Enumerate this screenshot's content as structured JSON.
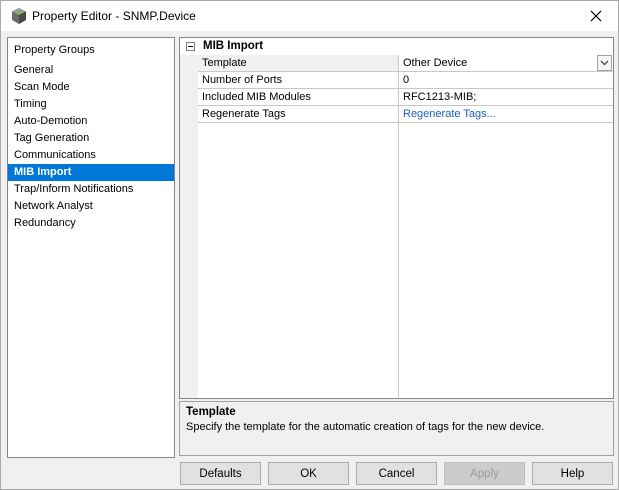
{
  "window": {
    "title": "Property Editor - SNMP.Device"
  },
  "groups": {
    "header": "Property Groups",
    "items": [
      "General",
      "Scan Mode",
      "Timing",
      "Auto-Demotion",
      "Tag Generation",
      "Communications",
      "MIB Import",
      "Trap/Inform Notifications",
      "Network Analyst",
      "Redundancy"
    ],
    "selected": "MIB Import"
  },
  "grid": {
    "category": "MIB Import",
    "properties": [
      {
        "name": "Template",
        "value": "Other Device"
      },
      {
        "name": "Number of Ports",
        "value": "0"
      },
      {
        "name": "Included MIB Modules",
        "value": "RFC1213-MIB;"
      },
      {
        "name": "Regenerate Tags",
        "value": "Regenerate Tags..."
      }
    ]
  },
  "description": {
    "title": "Template",
    "text": "Specify the template for the automatic creation of tags for the new device."
  },
  "buttons": {
    "defaults": "Defaults",
    "ok": "OK",
    "cancel": "Cancel",
    "apply": "Apply",
    "help": "Help"
  }
}
